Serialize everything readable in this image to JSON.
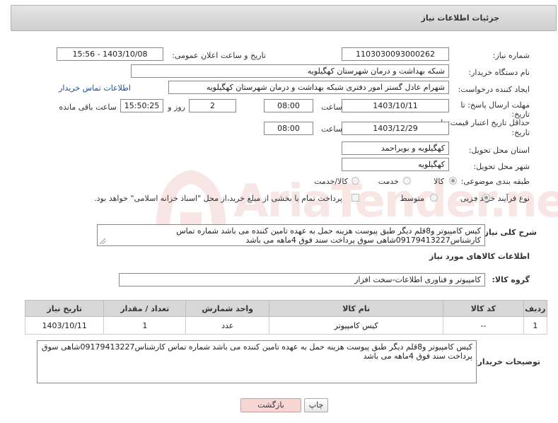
{
  "header": {
    "title": "جزئیات اطلاعات نیاز"
  },
  "form": {
    "need_number": {
      "label": "شماره نیاز:",
      "value": "1103030093000262"
    },
    "announce_datetime": {
      "label": "تاریخ و ساعت اعلان عمومی:",
      "value": "1403/10/08 - 15:56"
    },
    "buyer_org": {
      "label": "نام دستگاه خریدار:",
      "value": "شبکه بهداشت و درمان شهرستان کهگیلویه"
    },
    "requester": {
      "label": "ایجاد کننده درخواست:",
      "value": "شهرام عادل گستر امور دفتری شبکه بهداشت و درمان شهرستان کهگیلویه",
      "contact_link": "اطلاعات تماس خریدار"
    },
    "reply_deadline": {
      "label_line1": "مهلت ارسال پاسخ: تا",
      "label_line2": "تاریخ:",
      "date": "1403/10/11",
      "time_label": "ساعت",
      "time": "08:00",
      "days": "2",
      "day_label": "روز و",
      "remaining": "15:50:25",
      "remaining_label": "ساعت باقی مانده"
    },
    "price_validity": {
      "label_line1": "حداقل تاریخ اعتبار قیمت: تا",
      "label_line2": "تاریخ:",
      "date": "1403/12/29",
      "time_label": "ساعت",
      "time": "08:00"
    },
    "province": {
      "label": "استان محل تحویل:",
      "value": "کهگیلویه و بویراحمد"
    },
    "city": {
      "label": "شهر محل تحویل:",
      "value": "کهگیلویه"
    },
    "category": {
      "label": "طبقه بندی موضوعی:",
      "options": [
        "کالا",
        "خدمت",
        "کالا/خدمت"
      ],
      "selected": "کالا"
    },
    "process_type": {
      "label": "نوع فرآیند خرید :",
      "options": [
        "جزیی",
        "متوسط"
      ],
      "selected": "جزیی",
      "note": "پرداخت تمام یا بخشی از مبلغ خرید،از محل \"اسناد خزانه اسلامی\" خواهد بود."
    },
    "description": {
      "label": "شرح کلی نیاز:",
      "value": "کیس کامپیوتر و8قلم دیگر طبق پیوست هزینه حمل به عهده تامین کننده می باشد شماره تماس کارشناس09179413227شاهی سوق پرداخت سند فوق 4ماهه می باشد"
    }
  },
  "goods_section": {
    "title": "اطلاعات کالاهای مورد نیاز",
    "group_label": "گروه کالا:",
    "group_value": "کامپیوتر و فناوری اطلاعات-سخت افزار",
    "columns": [
      "ردیف",
      "کد کالا",
      "نام کالا",
      "واحد شمارش",
      "تعداد / مقدار",
      "تاریخ نیاز"
    ],
    "rows": [
      [
        "1",
        "--",
        "کیس کامپیوتر",
        "عدد",
        "1",
        "1403/10/11"
      ]
    ]
  },
  "buyer_notes": {
    "label": "توضیحات خریدار:",
    "value": "کیس کامپیوتر و8قلم دیگر طبق پیوست هزینه حمل به عهده تامین کننده می باشد شماره تماس کارشناس09179413227شاهی سوق پرداخت سند فوق 4ماهه می باشد"
  },
  "buttons": {
    "print": "چاپ",
    "back": "بازگشت"
  },
  "watermark": {
    "text": "AriaTender.neT"
  },
  "colors": {
    "link": "#1a4fa0",
    "back_button_bg": "#f7d6d6",
    "watermark": "#c0392b"
  }
}
